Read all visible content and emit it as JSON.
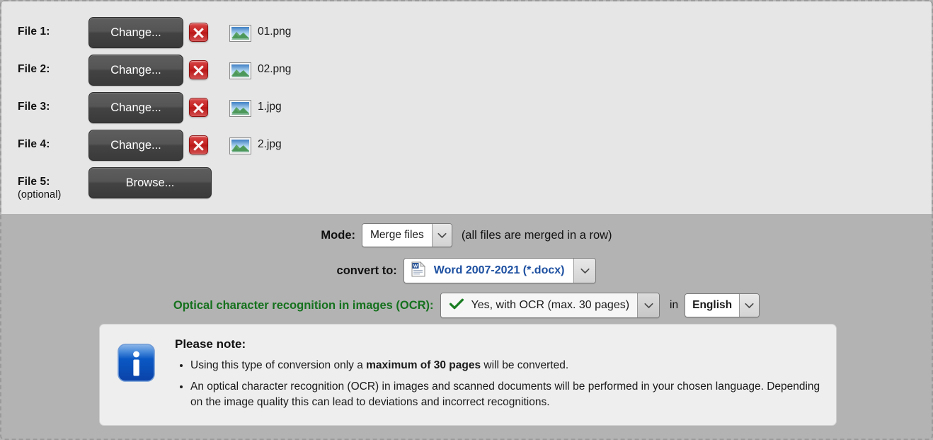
{
  "files": {
    "rows": [
      {
        "label": "File 1:",
        "button": "Change...",
        "delete_title": "remove file",
        "icon": "image-file-icon",
        "name": "01.png"
      },
      {
        "label": "File 2:",
        "button": "Change...",
        "delete_title": "remove file",
        "icon": "image-file-icon",
        "name": "02.png"
      },
      {
        "label": "File 3:",
        "button": "Change...",
        "delete_title": "remove file",
        "icon": "image-file-icon",
        "name": "1.jpg"
      },
      {
        "label": "File 4:",
        "button": "Change...",
        "delete_title": "remove file",
        "icon": "image-file-icon",
        "name": "2.jpg"
      }
    ],
    "optional_row": {
      "label": "File 5:",
      "sub_label": "(optional)",
      "button": "Browse..."
    }
  },
  "options": {
    "mode": {
      "label": "Mode:",
      "value": "Merge files",
      "hint": "(all files are merged in a row)"
    },
    "convert": {
      "label": "convert to:",
      "value": "Word 2007-2021 (*.docx)",
      "icon": "word-document-icon"
    },
    "ocr": {
      "label": "Optical character recognition in images (OCR):",
      "value": "Yes, with OCR (max. 30 pages)",
      "check_icon": "green-check-icon",
      "in_word": "in",
      "language": "English"
    }
  },
  "note": {
    "title": "Please note:",
    "items": [
      {
        "pre": "Using this type of conversion only a ",
        "bold": "maximum of 30 pages",
        "post": " will be converted."
      },
      {
        "pre": "An optical character recognition (OCR) in images and scanned documents will be performed in your chosen language. Depending on the image quality this can lead to deviations and incorrect recognitions.",
        "bold": "",
        "post": ""
      }
    ]
  },
  "colors": {
    "panel_light": "#e6e6e6",
    "panel_gray": "#b3b3b3",
    "ocr_label_green": "#15711d",
    "convert_value_blue": "#1c4fa0",
    "delete_red": "#c41f1f",
    "note_bg": "#eeeeee"
  }
}
